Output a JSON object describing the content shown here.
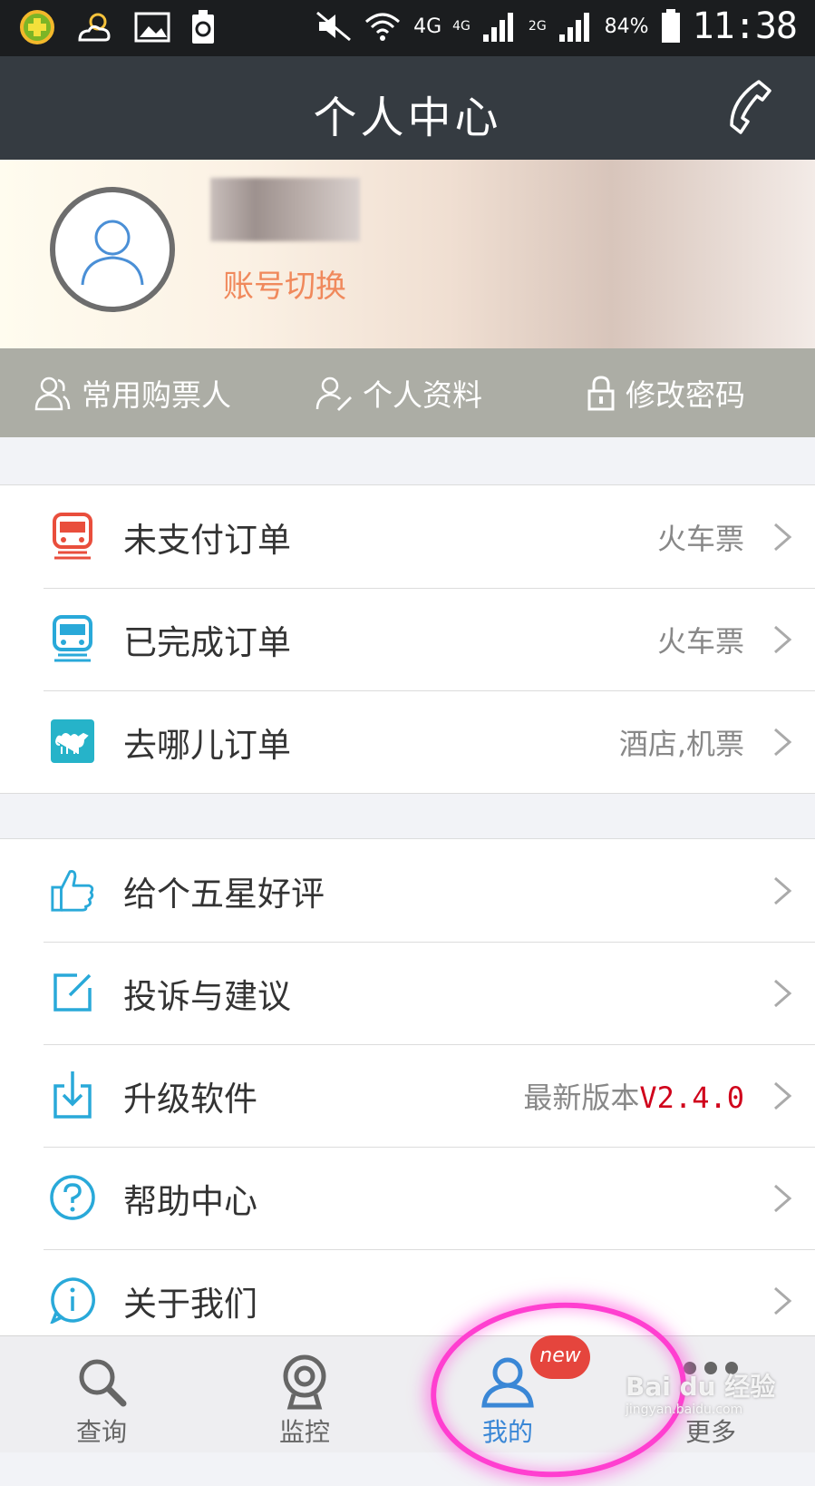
{
  "status_bar": {
    "network": "4G",
    "signal_1": "4G",
    "signal_2": "2G",
    "battery": "84%",
    "time": "11:38"
  },
  "header": {
    "title": "个人中心",
    "phone_icon": "phone-icon"
  },
  "profile": {
    "switch_account": "账号切换",
    "actions": [
      {
        "label": "常用购票人",
        "icon": "passengers-icon"
      },
      {
        "label": "个人资料",
        "icon": "profile-edit-icon"
      },
      {
        "label": "修改密码",
        "icon": "lock-icon"
      }
    ]
  },
  "orders": [
    {
      "label": "未支付订单",
      "value": "火车票",
      "icon": "train-icon",
      "color": "#e94e3c"
    },
    {
      "label": "已完成订单",
      "value": "火车票",
      "icon": "train-icon",
      "color": "#29a9d9"
    },
    {
      "label": "去哪儿订单",
      "value": "酒店,机票",
      "icon": "camel-icon",
      "color": "#26b3c9"
    }
  ],
  "settings": [
    {
      "label": "给个五星好评",
      "value": "",
      "icon": "thumbs-up-icon"
    },
    {
      "label": "投诉与建议",
      "value": "",
      "icon": "edit-icon"
    },
    {
      "label": "升级软件",
      "value_prefix": "最新版本",
      "value_version": "V2.4.0",
      "icon": "download-icon"
    },
    {
      "label": "帮助中心",
      "value": "",
      "icon": "help-icon"
    },
    {
      "label": "关于我们",
      "value": "",
      "icon": "info-icon"
    }
  ],
  "tabs": [
    {
      "label": "查询",
      "icon": "search-icon"
    },
    {
      "label": "监控",
      "icon": "camera-icon"
    },
    {
      "label": "我的",
      "icon": "user-icon",
      "active": true
    },
    {
      "label": "更多",
      "icon": "more-icon"
    }
  ],
  "badge": "new",
  "watermark": {
    "text": "Bai du 经验",
    "url": "jingyan.baidu.com"
  },
  "colors": {
    "accent": "#3a87d6",
    "header_bg": "#353b41",
    "switch_account": "#f0895c",
    "version": "#d0021b"
  }
}
